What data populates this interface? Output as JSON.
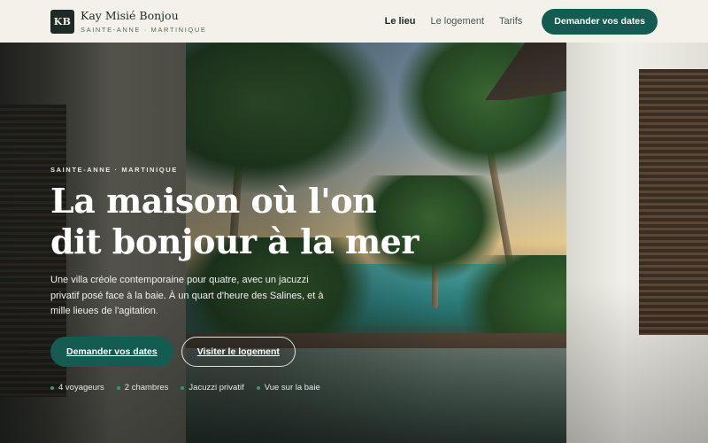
{
  "header": {
    "logo_initials": "KB",
    "brand_name": "Kay Misié Bonjou",
    "brand_location": "SAINTE-ANNE · MARTINIQUE",
    "nav": [
      {
        "label": "Le lieu",
        "active": true
      },
      {
        "label": "Le logement",
        "active": false
      },
      {
        "label": "Tarifs",
        "active": false
      }
    ],
    "cta_label": "Demander vos dates"
  },
  "hero": {
    "eyebrow": "SAINTE-ANNE · MARTINIQUE",
    "title": "La maison où l'on dit bonjour à la mer",
    "lede": "Une villa créole contemporaine pour quatre, avec un jacuzzi privatif posé face à la baie. À un quart d'heure des Salines, et à mille lieues de l'agitation.",
    "primary_button": "Demander vos dates",
    "secondary_button": "Visiter le logement",
    "features": [
      "4 voyageurs",
      "2 chambres",
      "Jacuzzi privatif",
      "Vue sur la baie"
    ]
  },
  "colors": {
    "accent": "#145c52",
    "header_bg": "#f4f1ea",
    "logo_bg": "#1d2a26",
    "feature_dot": "#2f9a7e"
  }
}
